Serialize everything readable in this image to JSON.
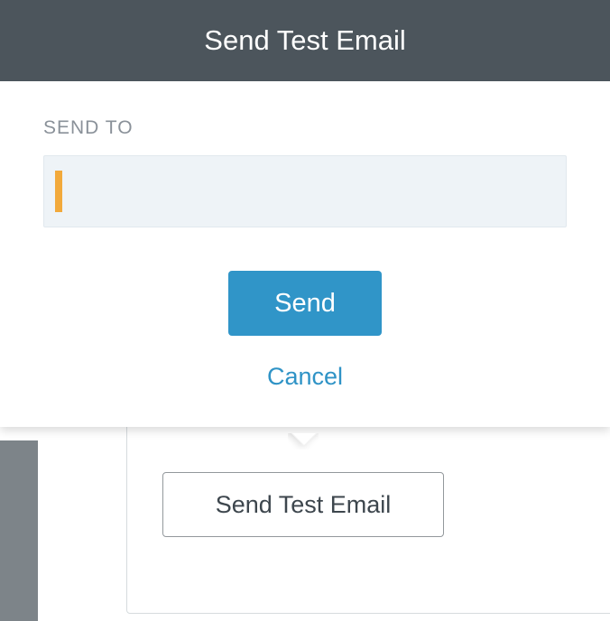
{
  "modal": {
    "title": "Send Test Email",
    "field_label": "SEND TO",
    "input_value": "",
    "send_label": "Send",
    "cancel_label": "Cancel"
  },
  "popover_button": {
    "label": "Send Test Email"
  }
}
